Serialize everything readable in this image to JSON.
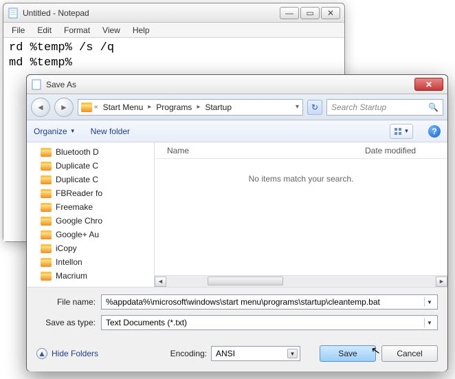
{
  "notepad": {
    "title": "Untitled - Notepad",
    "menu": {
      "file": "File",
      "edit": "Edit",
      "format": "Format",
      "view": "View",
      "help": "Help"
    },
    "content": "rd %temp% /s /q\nmd %temp%"
  },
  "saveas": {
    "title": "Save As",
    "nav": {
      "back_glyph": "◄",
      "fwd_glyph": "►",
      "crumb_prefix": "«",
      "crumbs": [
        "Start Menu",
        "Programs",
        "Startup"
      ],
      "refresh_glyph": "↻",
      "search_placeholder": "Search Startup",
      "search_icon": "🔍"
    },
    "toolbar": {
      "organize": "Organize",
      "newfolder": "New folder",
      "help_glyph": "?"
    },
    "tree": [
      "Bluetooth D",
      "Duplicate C",
      "Duplicate C",
      "FBReader fo",
      "Freemake",
      "Google Chro",
      "Google+ Au",
      "iCopy",
      "Intellon",
      "Macrium"
    ],
    "columns": {
      "name": "Name",
      "date": "Date modified"
    },
    "empty_text": "No items match your search.",
    "filename_label": "File name:",
    "filename_value": "%appdata%\\microsoft\\windows\\start menu\\programs\\startup\\cleantemp.bat",
    "savetype_label": "Save as type:",
    "savetype_value": "Text Documents (*.txt)",
    "hide_folders": "Hide Folders",
    "hide_glyph": "▲",
    "encoding_label": "Encoding:",
    "encoding_value": "ANSI",
    "save_btn": "Save",
    "cancel_btn": "Cancel",
    "close_glyph": "✕",
    "min_glyph": "—",
    "max_glyph": "▭"
  }
}
